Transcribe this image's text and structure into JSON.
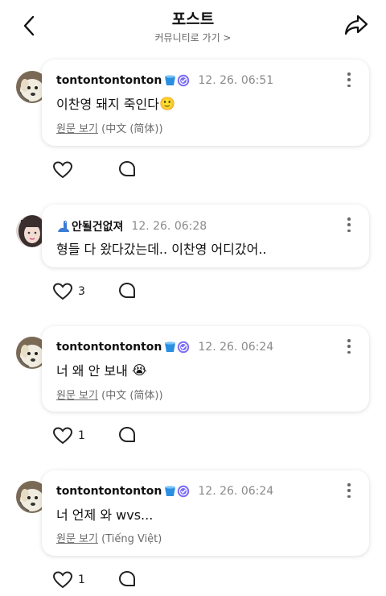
{
  "header": {
    "title": "포스트",
    "subtitle": "커뮤니티로 가기 >"
  },
  "posts": [
    {
      "username": "tontontontonton",
      "badges": [
        "bucket-emoji",
        "verified-icon"
      ],
      "time": "12. 26. 06:51",
      "text": "이찬영 돼지 죽인다",
      "emoji": "🙂",
      "translate_link": "원문 보기",
      "translate_lang": " (中文 (简体))",
      "likes": ""
    },
    {
      "username": "안될건없져",
      "badges": [
        "dinosaur-emoji"
      ],
      "time": "12. 26. 06:28",
      "text": "형들 다 왔다갔는데.. 이찬영 어디갔어..",
      "emoji": "",
      "translate_link": "",
      "translate_lang": "",
      "likes": "3"
    },
    {
      "username": "tontontontonton",
      "badges": [
        "bucket-emoji",
        "verified-icon"
      ],
      "time": "12. 26. 06:24",
      "text": "너 왜 안 보내",
      "emoji": "😭",
      "translate_link": "원문 보기",
      "translate_lang": " (中文 (简体))",
      "likes": "1"
    },
    {
      "username": "tontontontonton",
      "badges": [
        "bucket-emoji",
        "verified-icon"
      ],
      "time": "12. 26. 06:24",
      "text": "너 언제 와 wvs...",
      "emoji": "",
      "translate_link": "원문 보기",
      "translate_lang": " (Tiếng Việt)",
      "likes": "1"
    }
  ],
  "colors": {
    "verified": "#7b6cf6",
    "bucket": "#2a8fe0",
    "dino": "#3a7bd5"
  }
}
